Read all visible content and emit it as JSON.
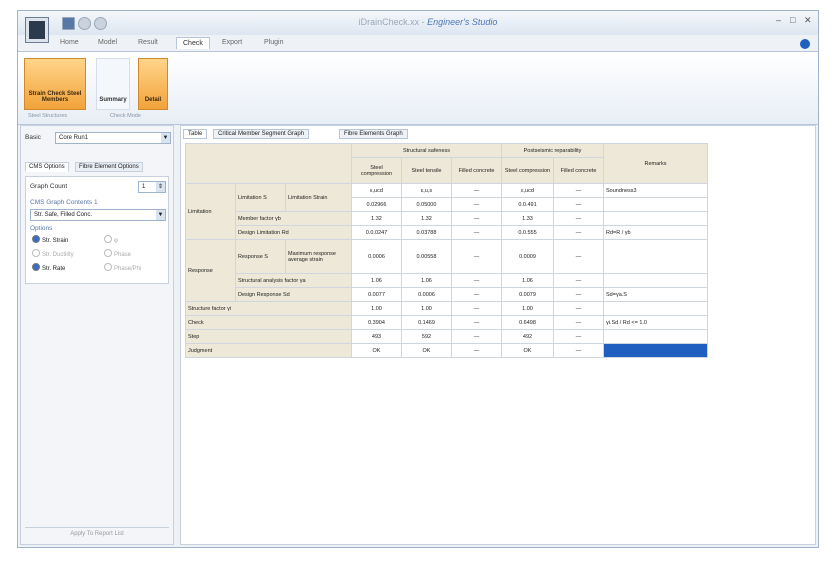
{
  "window": {
    "title_app": "iDrainCheck.xx",
    "title_brand": "Engineer's Studio"
  },
  "menu_tabs": [
    "Home",
    "Model",
    "Result",
    "Check",
    "Export",
    "Plugin"
  ],
  "active_tab": "Check",
  "ribbon": {
    "buttons": [
      {
        "label": "Strain Check Steel Members",
        "style": "orange"
      },
      {
        "label": "Summary",
        "style": "plain"
      },
      {
        "label": "Detail",
        "style": "orange"
      }
    ],
    "groups": [
      "Steel Structures",
      "Check Mode"
    ]
  },
  "left_panel": {
    "basic_label": "Basic",
    "basic_value": "Core Run1",
    "tabs": [
      "CMS Options",
      "Fibre Element Options"
    ],
    "graph_count_label": "Graph Count",
    "graph_count_value": "1",
    "graph_contents_label": "CMS Graph Contents 1",
    "graph_contents_value": "Str. Safe, Filled Conc.",
    "options_label": "Options",
    "radios": [
      {
        "label": "Str. Strain",
        "state": "on"
      },
      {
        "label": "φ",
        "state": "off"
      },
      {
        "label": "Str. Ductility",
        "state": "off"
      },
      {
        "label": "Phase",
        "state": "off"
      },
      {
        "label": "Str. Rate",
        "state": "on"
      },
      {
        "label": "Phase/Phi",
        "state": "off"
      }
    ],
    "apply_label": "Apply To Report List"
  },
  "panel_tabs": [
    "Table",
    "Critical Member Segment Graph",
    "Fibre Elements Graph"
  ],
  "table": {
    "group_headers": [
      "Structural safeness",
      "Postseismic reparability",
      "Remarks"
    ],
    "sub_headers": [
      "Steel compression",
      "Steel tensile",
      "Filled concrete",
      "Steel compression",
      "Filled concrete"
    ],
    "row_labels": {
      "limitation": "Limitation",
      "limitation_s": "Limitation S",
      "limitation_strain": "Limitation Strain",
      "member_factor": "Member factor γb",
      "design_limitation": "Design Limitation Rd",
      "response": "Response",
      "response_s": "Response S",
      "max_response": "Maximum response average strain",
      "struct_analysis": "Structural analysis factor γa",
      "design_response": "Design Response Sd",
      "structure_factor": "Structure factor γi",
      "check": "Check",
      "step": "Step",
      "judgment": "Judgment"
    },
    "rows": {
      "limitation_strain": [
        "ε,ucd",
        "ε,u,s",
        "—",
        "ε,ucd",
        "—",
        "Soundness3"
      ],
      "limitation_val": [
        "0.02966",
        "0.05000",
        "—",
        "0.0.491",
        "—",
        ""
      ],
      "member_factor": [
        "1.32",
        "1.32",
        "—",
        "1.33",
        "—",
        ""
      ],
      "design_limitation": [
        "0.0.0247",
        "0.03788",
        "—",
        "0.0.555",
        "—",
        "Rd=R / γb"
      ],
      "max_response": [
        "0.0006",
        "0.00558",
        "—",
        "0.0009",
        "—",
        ""
      ],
      "struct_analysis": [
        "1.06",
        "1.06",
        "—",
        "1.06",
        "—",
        ""
      ],
      "design_response": [
        "0.0077",
        "0.0006",
        "—",
        "0.0079",
        "—",
        "Sd=γa.S"
      ],
      "structure_factor": [
        "1.00",
        "1.00",
        "—",
        "1.00",
        "—",
        ""
      ],
      "check": [
        "0.3904",
        "0.1469",
        "—",
        "0.6498",
        "—",
        "γi.Sd / Rd <= 1.0"
      ],
      "step": [
        "493",
        "592",
        "—",
        "492",
        "—",
        ""
      ],
      "judgment": [
        "OK",
        "OK",
        "—",
        "OK",
        "—",
        ""
      ]
    }
  }
}
